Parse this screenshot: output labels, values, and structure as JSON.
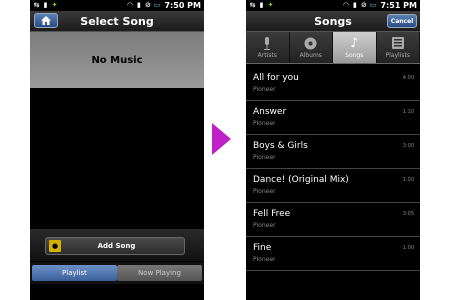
{
  "left": {
    "status": {
      "time": "7:50 PM"
    },
    "title": "Select Song",
    "empty_message": "No Music",
    "add_song_label": "Add Song",
    "tabs": [
      {
        "label": "Playlist",
        "active": true
      },
      {
        "label": "Now Playing",
        "active": false
      }
    ]
  },
  "right": {
    "status": {
      "time": "7:51 PM"
    },
    "title": "Songs",
    "cancel_label": "Cancel",
    "tabs": [
      {
        "label": "Artists",
        "icon": "microphone-icon"
      },
      {
        "label": "Albums",
        "icon": "album-icon"
      },
      {
        "label": "Songs",
        "icon": "music-note-icon",
        "active": true
      },
      {
        "label": "Playlists",
        "icon": "playlist-icon"
      }
    ],
    "songs": [
      {
        "title": "All for you",
        "artist": "Pioneer",
        "duration": "4:00"
      },
      {
        "title": "Answer",
        "artist": "Pioneer",
        "duration": "1:10"
      },
      {
        "title": "Boys & Girls",
        "artist": "Pioneer",
        "duration": "3:00"
      },
      {
        "title": "Dance! (Original Mix)",
        "artist": "Pioneer",
        "duration": "1:00"
      },
      {
        "title": "Fell Free",
        "artist": "Pioneer",
        "duration": "3:05"
      },
      {
        "title": "Fine",
        "artist": "Pioneer",
        "duration": "1:00"
      }
    ]
  },
  "colors": {
    "arrow": "#c020c8",
    "active_tab": "#4a6fab"
  }
}
